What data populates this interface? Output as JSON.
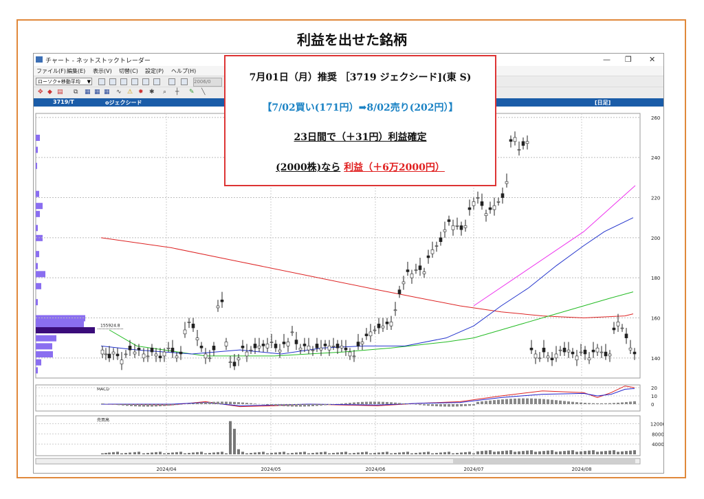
{
  "headline": "利益を出せた銘柄",
  "window": {
    "title": "チャート - ネットストックトレーダー",
    "buttons": {
      "minimize": "—",
      "restore": "❐",
      "close": "✕"
    },
    "menu": [
      "ファイル(F)",
      "編集(E)",
      "表示(V)",
      "切替(C)",
      "設定(P)",
      "ヘルプ(H)"
    ],
    "toolbar_select": "ローソク+移動平均",
    "toolbar_date": "2006/0",
    "code": "3719/T",
    "stock_name": "oジェクシード",
    "period": "[日足]"
  },
  "note": {
    "line1": "7月01日（月）推奨 ［3719 ジェクシード](東 S)",
    "line2": "【7/02買い(171円）➡8/02売り(202円）】",
    "line3": "23日間で（＋31円）利益確定",
    "line4_prefix": "(2000株)なら",
    "line4_profit": "利益（＋6万2000円）"
  },
  "chart_data": {
    "type": "candlestick",
    "price_axis_ticks": [
      "260",
      "240",
      "220",
      "200",
      "180",
      "160",
      "140"
    ],
    "macd_label": "MACD",
    "macd_axis_ticks": [
      "20",
      "10",
      "0"
    ],
    "volume_label": "売買高",
    "volume_axis_ticks": [
      "12000",
      "8000",
      "4000"
    ],
    "x_tick_labels": [
      "2024/04",
      "2024/05",
      "2024/06",
      "2024/07",
      "2024/08"
    ],
    "price_line_label": "155924.8",
    "ylim": [
      130,
      262
    ],
    "colors": {
      "up": "#ffffff",
      "down": "#222222",
      "ma_short": "#2233cc",
      "ma_mid": "#22bb22",
      "ma_long": "#dd2222",
      "trend": "#ee33ee",
      "volume_profile": "#8a6ef0",
      "volume_profile_peak": "#3a0c7a"
    }
  }
}
